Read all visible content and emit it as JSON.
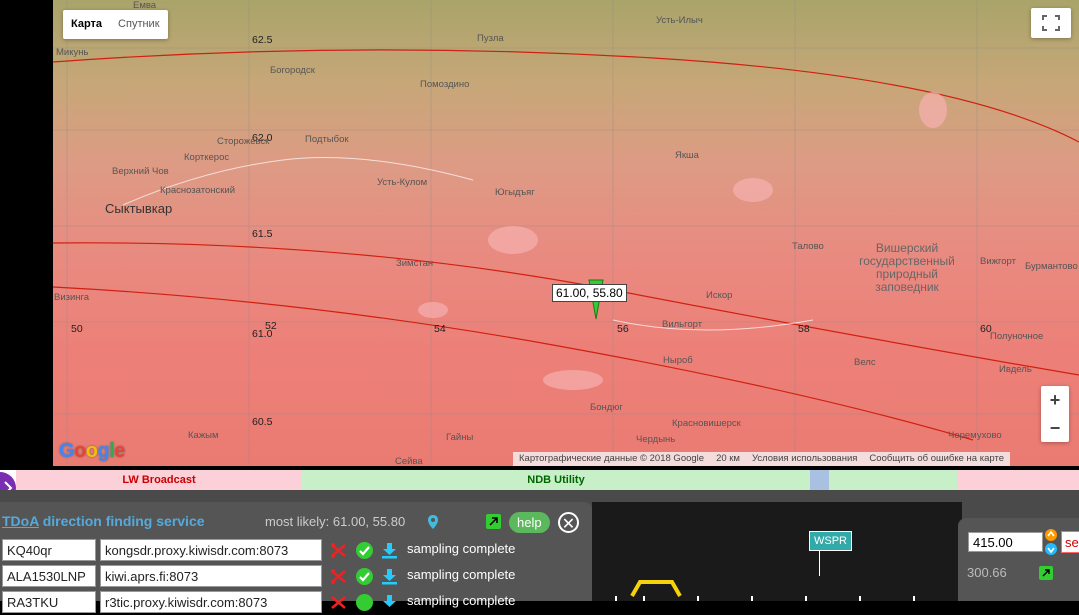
{
  "map": {
    "type_buttons": [
      "Карта",
      "Спутник"
    ],
    "active_type": "Карта",
    "position_label": "61.00, 55.80",
    "cities": {
      "syktyvkar": "Сыктывкар",
      "reserve": "Вишерский государственный природный заповедник"
    },
    "places": [
      "Емва",
      "Микунь",
      "Пузла",
      "Усть-Илыч",
      "Богородск",
      "Помоздино",
      "Сторожевск",
      "Подтыбок",
      "Корткерос",
      "Верхний Чов",
      "Краснозатонский",
      "Усть-Кулом",
      "Югыдъяг",
      "Якша",
      "Зимстан",
      "Талово",
      "Вижгорт",
      "Бурмантово",
      "Визинга",
      "Вильгорт",
      "Искор",
      "Полуночное",
      "Нырoб",
      "Велс",
      "Ивдель",
      "Бондюг",
      "Красновишерск",
      "Кажым",
      "Гайны",
      "Чердынь",
      "Чeремухово",
      "Сейва"
    ],
    "grid_labels": {
      "lat": [
        "62.5",
        "62.0",
        "61.5",
        "61.0",
        "60.5"
      ],
      "lon": [
        "50",
        "52",
        "54",
        "56",
        "58",
        "60"
      ]
    },
    "zoom_in": "+",
    "zoom_out": "−",
    "attribution": [
      "Картографические данные © 2018 Google",
      "20 км",
      "Условия использования",
      "Сообщить об ошибке на карте"
    ],
    "logo_letters": [
      "G",
      "o",
      "o",
      "g",
      "l",
      "e"
    ]
  },
  "bands": [
    {
      "label": "LW Broadcast",
      "color": "#fbd0d8"
    },
    {
      "label": "NDB Utility",
      "color": "#c8f0c8"
    },
    {
      "label": "",
      "color": "#aac0e0"
    },
    {
      "label": "",
      "color": "#c8f0c8"
    },
    {
      "label": "",
      "color": "#fbd0d8"
    }
  ],
  "spectrum": {
    "marker": "WSPR"
  },
  "tdoa": {
    "link_label": "TDoA",
    "title": "direction finding service",
    "most_likely": "most likely: 61.00, 55.80",
    "help": "help",
    "close": "✕",
    "rows": [
      {
        "callsign": "KQ40qr",
        "host": "kongsdr.proxy.kiwisdr.com:8073",
        "status": "sampling complete"
      },
      {
        "callsign": "ALA1530LNP",
        "host": "kiwi.aprs.fi:8073",
        "status": "sampling complete"
      },
      {
        "callsign": "RA3TKU",
        "host": "r3tic.proxy.kiwisdr.com:8073",
        "status": "sampling complete"
      }
    ]
  },
  "tuning": {
    "frequency": "415.00",
    "secondary": "300.66",
    "extra": "se"
  }
}
